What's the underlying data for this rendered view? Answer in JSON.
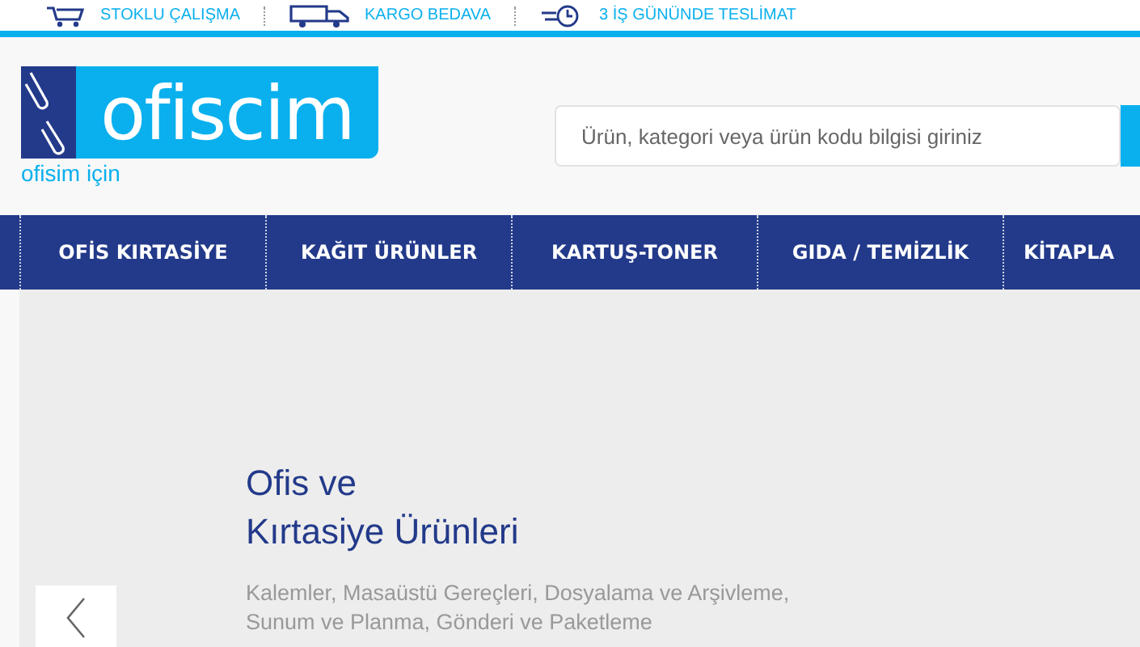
{
  "top_bar": {
    "items": [
      {
        "kind": "cart",
        "label": "STOKLU ÇALIŞMA"
      },
      {
        "kind": "truck",
        "label": "KARGO BEDAVA"
      },
      {
        "kind": "clock",
        "label": "3 İŞ GÜNÜNDE TESLİMAT"
      }
    ]
  },
  "header": {
    "logo": {
      "name": "ofiscim",
      "tagline": "ofisim için"
    },
    "search": {
      "placeholder": "Ürün, kategori veya ürün kodu bilgisi giriniz"
    }
  },
  "nav": {
    "items": [
      {
        "label": "OFİS KIRTASİYE"
      },
      {
        "label": "KAĞIT ÜRÜNLER"
      },
      {
        "label": "KARTUŞ-TONER"
      },
      {
        "label": "GIDA / TEMİZLİK"
      },
      {
        "label": "KİTAPLA"
      }
    ]
  },
  "hero": {
    "title_lines": [
      "Ofis ve",
      "Kırtasiye Ürünleri"
    ],
    "subtitle_lines": [
      "Kalemler, Masaüstü Gereçleri, Dosyalama ve Arşivleme,",
      "Sunum ve Planma, Gönderi ve Paketleme"
    ]
  }
}
